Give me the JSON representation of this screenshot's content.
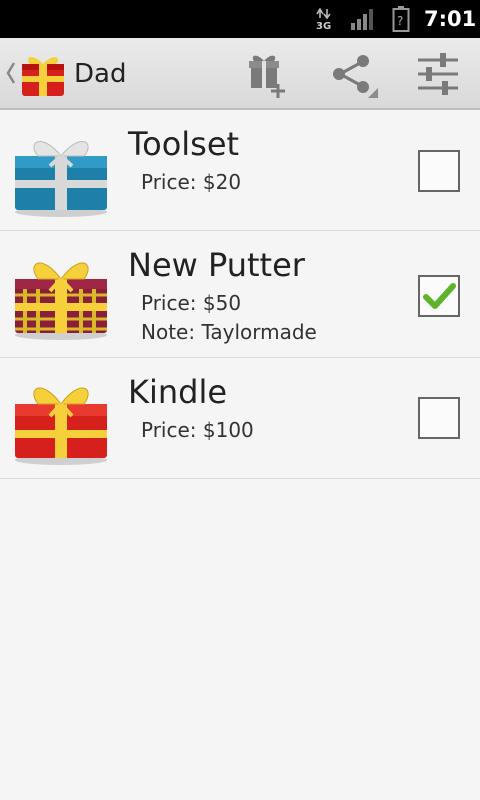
{
  "status_bar": {
    "network": "3G",
    "time": "7:01"
  },
  "action_bar": {
    "title": "Dad",
    "actions": [
      "add-gift-icon",
      "share-icon",
      "settings-sliders-icon"
    ]
  },
  "items": [
    {
      "name": "Toolset",
      "price": "Price: $20",
      "note": "",
      "checked": false,
      "gift_color": "#1e7fa8"
    },
    {
      "name": "New Putter",
      "price": "Price: $50",
      "note": "Note: Taylormade",
      "checked": true,
      "gift_color": "#8a1f3a"
    },
    {
      "name": "Kindle",
      "price": "Price: $100",
      "note": "",
      "checked": false,
      "gift_color": "#d6201c"
    }
  ],
  "colors": {
    "background": "#f5f5f5",
    "action_bar": "#e2e2e2",
    "check_green": "#5fb32a"
  }
}
